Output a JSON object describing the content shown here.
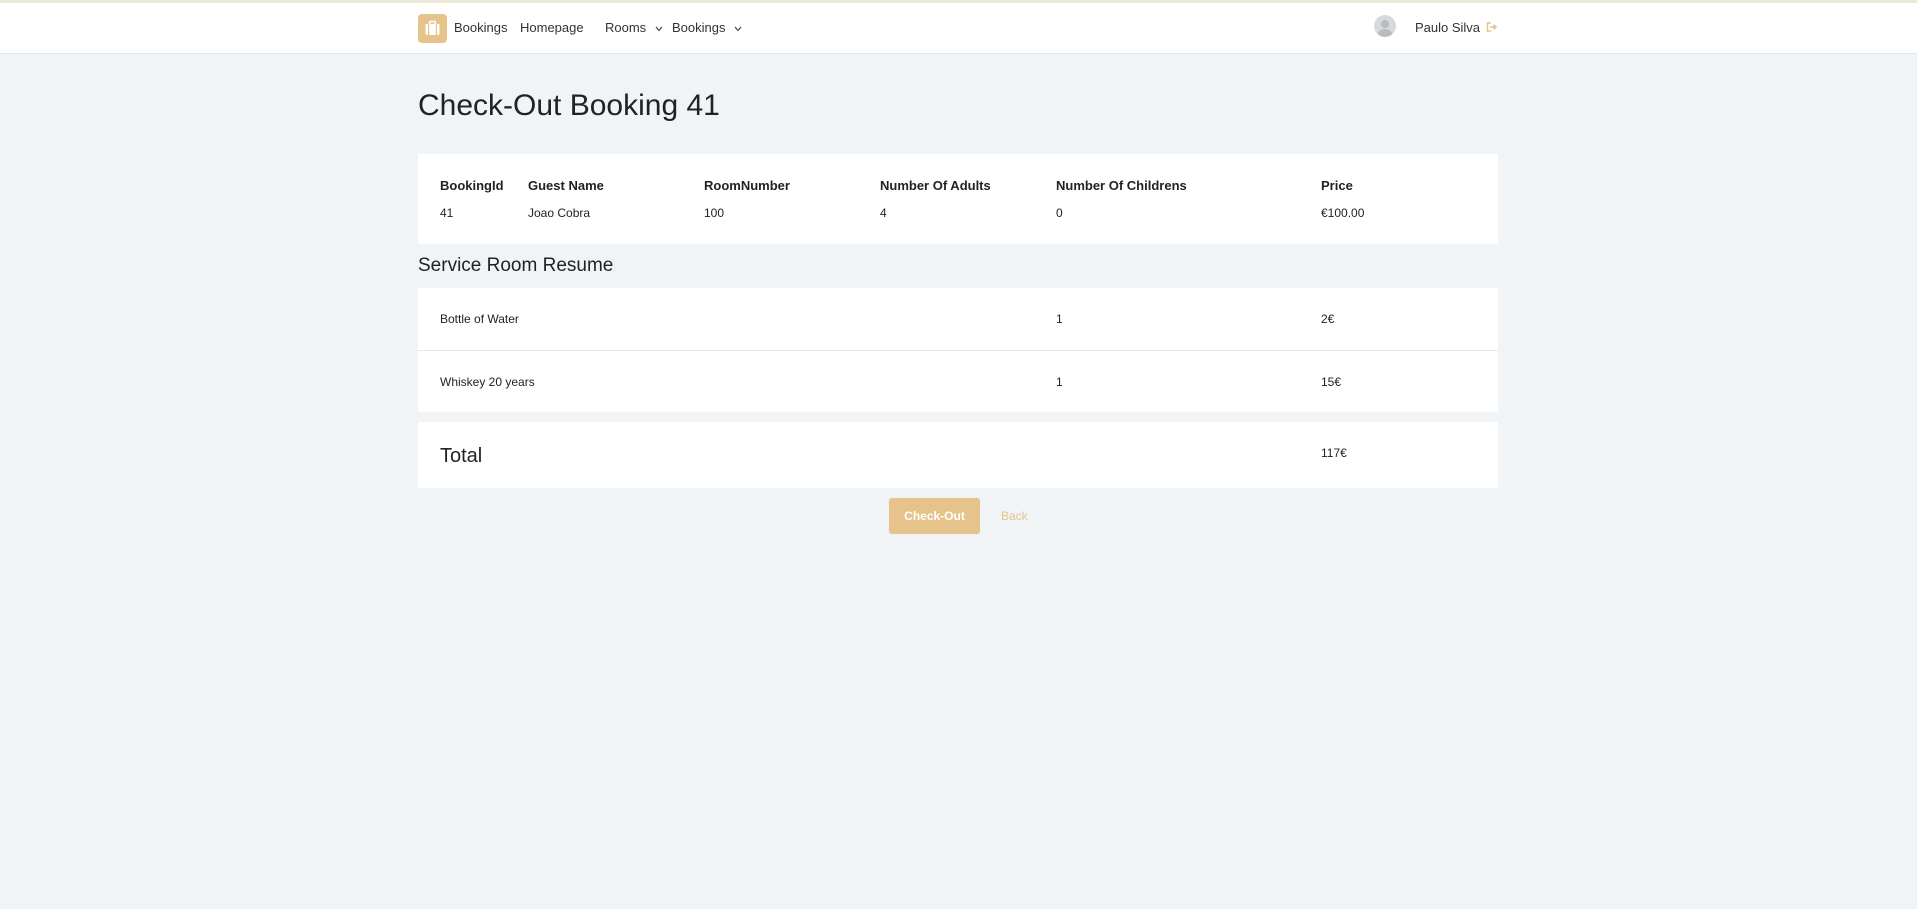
{
  "colors": {
    "accent": "#e6c38a",
    "background": "#f0f4f7",
    "card": "#ffffff"
  },
  "navbar": {
    "brand_label": "Bookings",
    "brand_icon": "suitcase-icon",
    "links": [
      {
        "label": "Homepage"
      },
      {
        "label": "Rooms",
        "has_dropdown": true
      },
      {
        "label": "Bookings",
        "has_dropdown": true
      }
    ],
    "user": {
      "name": "Paulo Silva",
      "avatar_icon": "user-avatar-icon",
      "logout_icon": "logout-icon"
    }
  },
  "page": {
    "title": "Check-Out Booking 41"
  },
  "booking_table": {
    "headers": [
      "BookingId",
      "Guest Name",
      "RoomNumber",
      "Number Of Adults",
      "Number Of Childrens",
      "Price"
    ],
    "row": [
      "41",
      "Joao Cobra",
      "100",
      "4",
      "0",
      "€100.00"
    ]
  },
  "service_section": {
    "title": "Service Room Resume",
    "items": [
      {
        "name": "Bottle of Water",
        "quantity": "1",
        "price": "2€"
      },
      {
        "name": "Whiskey 20 years",
        "quantity": "1",
        "price": "15€"
      }
    ]
  },
  "total": {
    "label": "Total",
    "value": "117€"
  },
  "actions": {
    "checkout_label": "Check-Out",
    "back_label": "Back"
  }
}
